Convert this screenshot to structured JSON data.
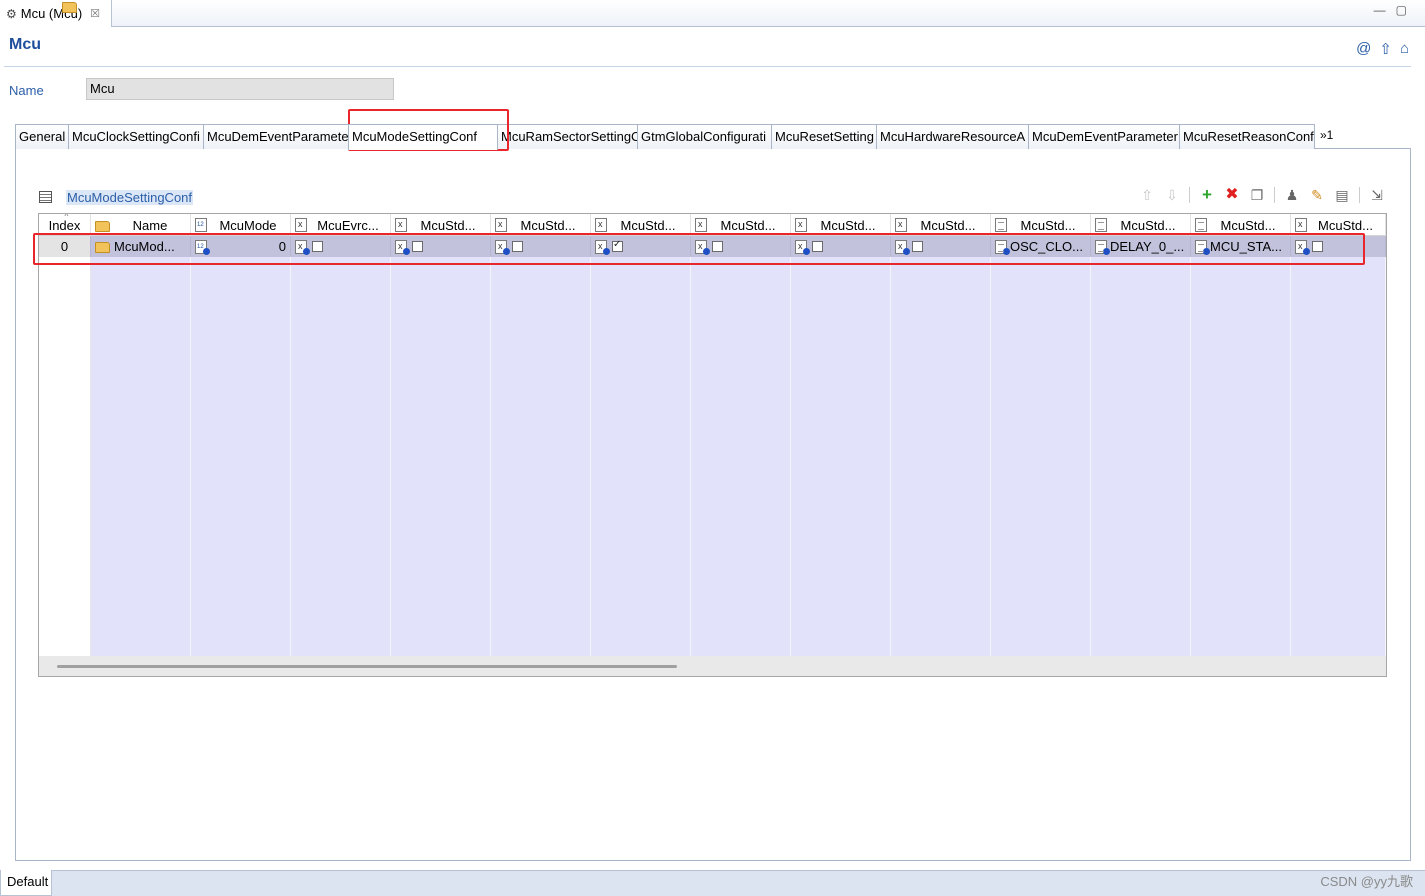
{
  "editor": {
    "tab_title": "Mcu (Mcu)",
    "close_glyph": "☒",
    "minimize_glyph": "—",
    "maximize_glyph": "▢"
  },
  "form": {
    "title": "Mcu",
    "name_label": "Name",
    "name_value": "Mcu"
  },
  "subtabs": [
    {
      "label": "General"
    },
    {
      "label": "McuClockSettingConfi"
    },
    {
      "label": "McuDemEventParameter"
    },
    {
      "label": "McuModeSettingConf"
    },
    {
      "label": "McuRamSectorSettingC"
    },
    {
      "label": "GtmGlobalConfigurati"
    },
    {
      "label": "McuResetSetting"
    },
    {
      "label": "McuHardwareResourceA"
    },
    {
      "label": "McuDemEventParameter"
    },
    {
      "label": "McuResetReasonConf"
    },
    {
      "label": "»1"
    }
  ],
  "active_subtab": "McuModeSettingConf",
  "table": {
    "section_title": "McuModeSettingConf",
    "columns": [
      {
        "label": "Index",
        "icon": "none"
      },
      {
        "label": "Name",
        "icon": "folder-icon"
      },
      {
        "label": "McuMode",
        "icon": "number-icon"
      },
      {
        "label": "McuEvrc...",
        "icon": "boolean-icon"
      },
      {
        "label": "McuStd...",
        "icon": "boolean-icon"
      },
      {
        "label": "McuStd...",
        "icon": "boolean-icon"
      },
      {
        "label": "McuStd...",
        "icon": "boolean-icon"
      },
      {
        "label": "McuStd...",
        "icon": "boolean-icon"
      },
      {
        "label": "McuStd...",
        "icon": "boolean-icon"
      },
      {
        "label": "McuStd...",
        "icon": "boolean-icon"
      },
      {
        "label": "McuStd...",
        "icon": "text-icon"
      },
      {
        "label": "McuStd...",
        "icon": "text-icon"
      },
      {
        "label": "McuStd...",
        "icon": "text-icon"
      },
      {
        "label": "McuStd...",
        "icon": "boolean-icon"
      }
    ],
    "row": {
      "index": "0",
      "name": "McuMod...",
      "mcu_mode": "0",
      "checkboxes": [
        false,
        false,
        false,
        true,
        false,
        false,
        false
      ],
      "text_values": [
        "OSC_CLO...",
        "DELAY_0_...",
        "MCU_STA..."
      ],
      "last_checkbox": false
    }
  },
  "toolbar": [
    "move-up-icon",
    "move-down-icon",
    "add-icon",
    "delete-icon",
    "copy-icon",
    "person-icon",
    "edit-icon",
    "table-edit-icon",
    "export-icon"
  ],
  "bottom": {
    "tab_label": "Default",
    "watermark": "CSDN @yy九歌"
  },
  "colors": {
    "accent_blue": "#1f4e9c",
    "selected_row": "#c2c2dc",
    "empty_row": "#e2e2fb",
    "highlight": "#e8262b"
  }
}
